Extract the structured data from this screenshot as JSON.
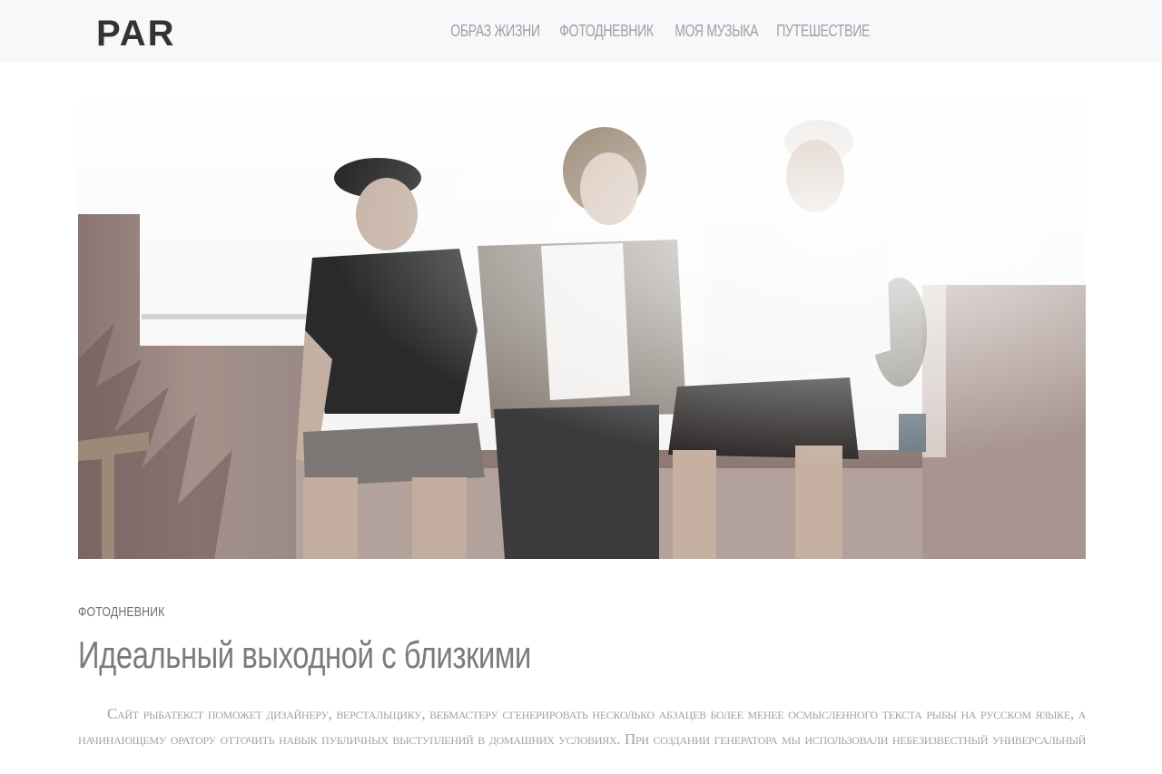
{
  "header": {
    "logo_text": "PAR",
    "nav": [
      {
        "label": "ОБРАЗ ЖИЗНИ"
      },
      {
        "label": "ФОТОДНЕВНИК"
      },
      {
        "label": "МОЯ МУЗЫКА"
      },
      {
        "label": "ПУТЕШЕСТВИЕ"
      }
    ]
  },
  "post": {
    "image_alt": "Three men sitting on a rooftop ledge",
    "category": "ФОТОДНЕВНИК",
    "title": "Идеальный выходной с близкими",
    "excerpt": "Сайт рыбатекст поможет дизайнеру, верстальщику, вебмастеру сгенерировать несколько абзацев более менее осмысленного текста рыбы на русском языке, а начинающему оратору отточить навык публичных выступлений в домашних условиях. При создании генератора мы использовали небезизвестный универсальный код речей. Текст генерируется"
  },
  "colors": {
    "header_bg": "#f7f8f9",
    "nav_text": "#9ca0a6",
    "title_text": "#7b7b7b",
    "excerpt_text": "#a1a1a1",
    "logo": "#333333"
  }
}
